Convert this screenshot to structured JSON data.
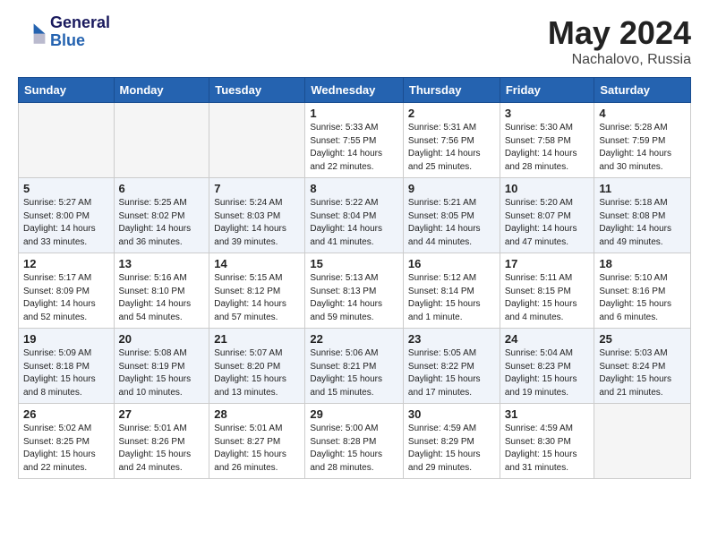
{
  "header": {
    "logo_line1": "General",
    "logo_line2": "Blue",
    "month_year": "May 2024",
    "location": "Nachalovo, Russia"
  },
  "days_of_week": [
    "Sunday",
    "Monday",
    "Tuesday",
    "Wednesday",
    "Thursday",
    "Friday",
    "Saturday"
  ],
  "weeks": [
    [
      {
        "day": "",
        "info": ""
      },
      {
        "day": "",
        "info": ""
      },
      {
        "day": "",
        "info": ""
      },
      {
        "day": "1",
        "info": "Sunrise: 5:33 AM\nSunset: 7:55 PM\nDaylight: 14 hours\nand 22 minutes."
      },
      {
        "day": "2",
        "info": "Sunrise: 5:31 AM\nSunset: 7:56 PM\nDaylight: 14 hours\nand 25 minutes."
      },
      {
        "day": "3",
        "info": "Sunrise: 5:30 AM\nSunset: 7:58 PM\nDaylight: 14 hours\nand 28 minutes."
      },
      {
        "day": "4",
        "info": "Sunrise: 5:28 AM\nSunset: 7:59 PM\nDaylight: 14 hours\nand 30 minutes."
      }
    ],
    [
      {
        "day": "5",
        "info": "Sunrise: 5:27 AM\nSunset: 8:00 PM\nDaylight: 14 hours\nand 33 minutes."
      },
      {
        "day": "6",
        "info": "Sunrise: 5:25 AM\nSunset: 8:02 PM\nDaylight: 14 hours\nand 36 minutes."
      },
      {
        "day": "7",
        "info": "Sunrise: 5:24 AM\nSunset: 8:03 PM\nDaylight: 14 hours\nand 39 minutes."
      },
      {
        "day": "8",
        "info": "Sunrise: 5:22 AM\nSunset: 8:04 PM\nDaylight: 14 hours\nand 41 minutes."
      },
      {
        "day": "9",
        "info": "Sunrise: 5:21 AM\nSunset: 8:05 PM\nDaylight: 14 hours\nand 44 minutes."
      },
      {
        "day": "10",
        "info": "Sunrise: 5:20 AM\nSunset: 8:07 PM\nDaylight: 14 hours\nand 47 minutes."
      },
      {
        "day": "11",
        "info": "Sunrise: 5:18 AM\nSunset: 8:08 PM\nDaylight: 14 hours\nand 49 minutes."
      }
    ],
    [
      {
        "day": "12",
        "info": "Sunrise: 5:17 AM\nSunset: 8:09 PM\nDaylight: 14 hours\nand 52 minutes."
      },
      {
        "day": "13",
        "info": "Sunrise: 5:16 AM\nSunset: 8:10 PM\nDaylight: 14 hours\nand 54 minutes."
      },
      {
        "day": "14",
        "info": "Sunrise: 5:15 AM\nSunset: 8:12 PM\nDaylight: 14 hours\nand 57 minutes."
      },
      {
        "day": "15",
        "info": "Sunrise: 5:13 AM\nSunset: 8:13 PM\nDaylight: 14 hours\nand 59 minutes."
      },
      {
        "day": "16",
        "info": "Sunrise: 5:12 AM\nSunset: 8:14 PM\nDaylight: 15 hours\nand 1 minute."
      },
      {
        "day": "17",
        "info": "Sunrise: 5:11 AM\nSunset: 8:15 PM\nDaylight: 15 hours\nand 4 minutes."
      },
      {
        "day": "18",
        "info": "Sunrise: 5:10 AM\nSunset: 8:16 PM\nDaylight: 15 hours\nand 6 minutes."
      }
    ],
    [
      {
        "day": "19",
        "info": "Sunrise: 5:09 AM\nSunset: 8:18 PM\nDaylight: 15 hours\nand 8 minutes."
      },
      {
        "day": "20",
        "info": "Sunrise: 5:08 AM\nSunset: 8:19 PM\nDaylight: 15 hours\nand 10 minutes."
      },
      {
        "day": "21",
        "info": "Sunrise: 5:07 AM\nSunset: 8:20 PM\nDaylight: 15 hours\nand 13 minutes."
      },
      {
        "day": "22",
        "info": "Sunrise: 5:06 AM\nSunset: 8:21 PM\nDaylight: 15 hours\nand 15 minutes."
      },
      {
        "day": "23",
        "info": "Sunrise: 5:05 AM\nSunset: 8:22 PM\nDaylight: 15 hours\nand 17 minutes."
      },
      {
        "day": "24",
        "info": "Sunrise: 5:04 AM\nSunset: 8:23 PM\nDaylight: 15 hours\nand 19 minutes."
      },
      {
        "day": "25",
        "info": "Sunrise: 5:03 AM\nSunset: 8:24 PM\nDaylight: 15 hours\nand 21 minutes."
      }
    ],
    [
      {
        "day": "26",
        "info": "Sunrise: 5:02 AM\nSunset: 8:25 PM\nDaylight: 15 hours\nand 22 minutes."
      },
      {
        "day": "27",
        "info": "Sunrise: 5:01 AM\nSunset: 8:26 PM\nDaylight: 15 hours\nand 24 minutes."
      },
      {
        "day": "28",
        "info": "Sunrise: 5:01 AM\nSunset: 8:27 PM\nDaylight: 15 hours\nand 26 minutes."
      },
      {
        "day": "29",
        "info": "Sunrise: 5:00 AM\nSunset: 8:28 PM\nDaylight: 15 hours\nand 28 minutes."
      },
      {
        "day": "30",
        "info": "Sunrise: 4:59 AM\nSunset: 8:29 PM\nDaylight: 15 hours\nand 29 minutes."
      },
      {
        "day": "31",
        "info": "Sunrise: 4:59 AM\nSunset: 8:30 PM\nDaylight: 15 hours\nand 31 minutes."
      },
      {
        "day": "",
        "info": ""
      }
    ]
  ]
}
